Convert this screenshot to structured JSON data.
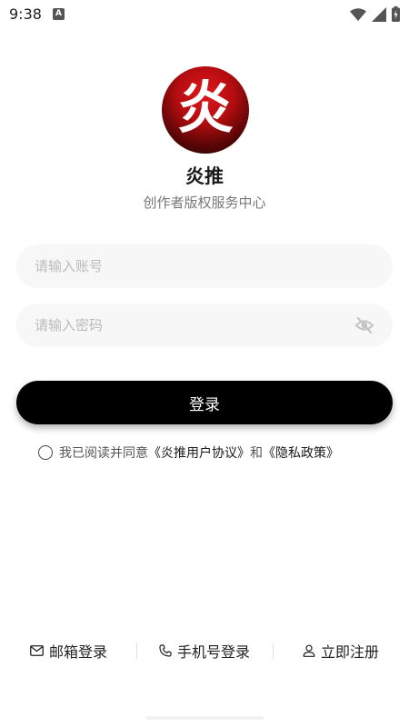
{
  "status_bar": {
    "time": "9:38",
    "notification_badge": "A"
  },
  "app": {
    "logo_char": "炎",
    "name": "炎推",
    "subtitle": "创作者版权服务中心"
  },
  "form": {
    "account_placeholder": "请输入账号",
    "password_placeholder": "请输入密码",
    "login_label": "登录"
  },
  "agreement": {
    "prefix": "我已阅读并同意",
    "user_agreement": "《炎推用户协议》",
    "conjunction": "和",
    "privacy_policy": "《隐私政策》"
  },
  "bottom_nav": {
    "email_login": "邮箱登录",
    "phone_login": "手机号登录",
    "register": "立即注册"
  },
  "colors": {
    "accent": "#000000",
    "logo_red": "#c0111a",
    "input_bg": "#f7f7f7"
  }
}
